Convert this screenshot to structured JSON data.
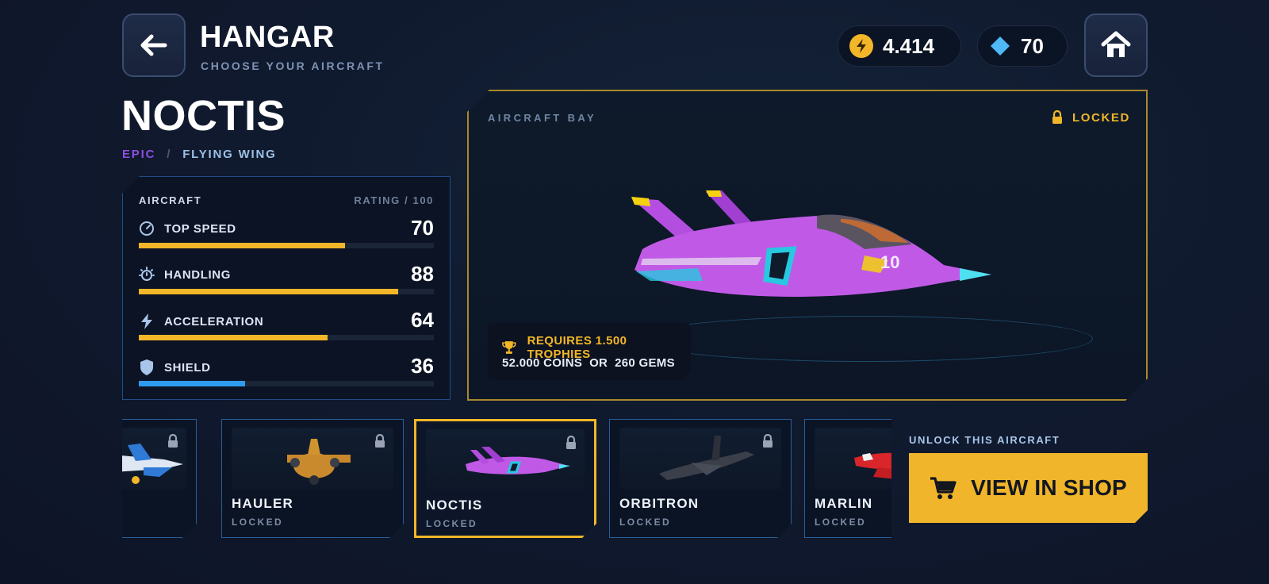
{
  "header": {
    "title": "HANGAR",
    "subtitle": "CHOOSE YOUR AIRCRAFT",
    "back_icon": "arrow-left-icon",
    "home_icon": "home-icon"
  },
  "currencies": {
    "coins": {
      "value": "4.414",
      "icon": "lightning-coin-icon",
      "color": "#f2b628"
    },
    "gems": {
      "value": "70",
      "icon": "diamond-gem-icon",
      "color": "#4fb8f5"
    }
  },
  "aircraft": {
    "name": "NOCTIS",
    "rarity": "EPIC",
    "separator": "/",
    "class": "FLYING WING",
    "rarity_color": "#8b4fe0"
  },
  "stats": {
    "header_left": "AIRCRAFT",
    "header_right": "RATING / 100",
    "items": [
      {
        "label": "TOP SPEED",
        "value": "70",
        "rating": 70,
        "icon": "speedometer-icon",
        "color": "#f2b628"
      },
      {
        "label": "HANDLING",
        "value": "88",
        "rating": 88,
        "icon": "stopwatch-icon",
        "color": "#f2b628"
      },
      {
        "label": "ACCELERATION",
        "value": "64",
        "rating": 64,
        "icon": "lightning-icon",
        "color": "#f2b628"
      },
      {
        "label": "SHIELD",
        "value": "36",
        "rating": 36,
        "icon": "shield-icon",
        "color": "#2f9bf0"
      }
    ]
  },
  "bay": {
    "title": "AIRCRAFT BAY",
    "lock_status": "LOCKED",
    "requirement": "REQUIRES 1.500 TROPHIES",
    "cost": "52.000 COINS  OR  260 GEMS",
    "trophy_icon": "trophy-icon"
  },
  "carousel": {
    "cards": [
      {
        "name": "",
        "status": "",
        "selected": false,
        "locked": true
      },
      {
        "name": "HAULER",
        "status": "LOCKED",
        "selected": false,
        "locked": true
      },
      {
        "name": "NOCTIS",
        "status": "LOCKED",
        "selected": true,
        "locked": true
      },
      {
        "name": "ORBITRON",
        "status": "LOCKED",
        "selected": false,
        "locked": true
      },
      {
        "name": "MARLIN",
        "status": "LOCKED",
        "selected": false,
        "locked": true
      }
    ]
  },
  "shop": {
    "unlock_label": "UNLOCK THIS AIRCRAFT",
    "button_label": "VIEW IN SHOP",
    "cart_icon": "cart-icon",
    "color": "#f0b52a"
  }
}
